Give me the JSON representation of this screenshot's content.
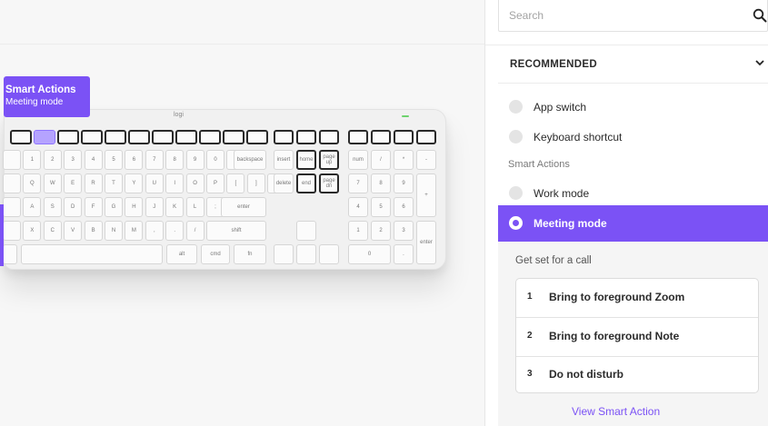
{
  "search": {
    "placeholder": "Search"
  },
  "recommended": {
    "title": "RECOMMENDED"
  },
  "options": [
    {
      "label": "App switch",
      "selected": false
    },
    {
      "label": "Keyboard shortcut",
      "selected": false
    }
  ],
  "smart_actions": {
    "section_label": "Smart Actions",
    "items": [
      {
        "label": "Work mode",
        "selected": false
      },
      {
        "label": "Meeting mode",
        "selected": true
      }
    ]
  },
  "detail": {
    "description": "Get set for a call",
    "steps": [
      {
        "num": "1",
        "label": "Bring to foreground Zoom"
      },
      {
        "num": "2",
        "label": "Bring to foreground Note"
      },
      {
        "num": "3",
        "label": "Do not disturb"
      }
    ],
    "link": "View Smart Action"
  },
  "callout": {
    "title": "Smart Actions",
    "subtitle": "Meeting mode"
  },
  "keyboard": {
    "brand": "logi",
    "keys": {
      "row1": [
        "",
        "",
        "",
        "",
        "",
        "",
        "",
        "",
        "",
        "",
        ""
      ],
      "nav1": [
        "print",
        "scroll",
        "pause"
      ],
      "nav2": [
        "insert",
        "home",
        "page up"
      ],
      "nav3": [
        "delete",
        "end",
        "page dn"
      ],
      "num": [
        "num",
        "/",
        "*",
        "-",
        "7",
        "8",
        "9",
        "+",
        "4",
        "5",
        "6",
        "1",
        "2",
        "3",
        "enter",
        "0",
        "."
      ],
      "main_row2": [
        "",
        "1",
        "2",
        "3",
        "4",
        "5",
        "6",
        "7",
        "8",
        "9",
        "0",
        "-",
        "=",
        "backspace"
      ],
      "main_row3": [
        "",
        "Q",
        "W",
        "E",
        "R",
        "T",
        "Y",
        "U",
        "I",
        "O",
        "P",
        "[",
        "]",
        "\\"
      ],
      "main_row4": [
        "",
        "A",
        "S",
        "D",
        "F",
        "G",
        "H",
        "J",
        "K",
        "L",
        ";",
        "'",
        "enter"
      ],
      "main_row5": [
        "",
        "X",
        "C",
        "V",
        "B",
        "N",
        "M",
        ",",
        ".",
        "/",
        "shift"
      ],
      "main_row6": [
        "",
        "",
        "alt",
        "cmd",
        "fn",
        "ctrl"
      ]
    }
  },
  "colors": {
    "accent": "#7b52f5",
    "accent_light": "#b5a3ff"
  }
}
